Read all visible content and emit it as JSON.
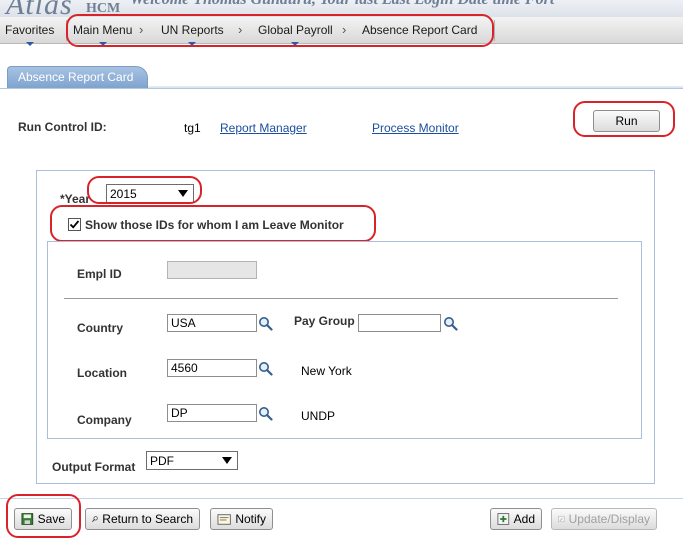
{
  "banner": {
    "brand": "Atlas",
    "brand_sub": "HCM",
    "message": "Welcome Thomas Gunduru, Your last Last Login Date time Fort"
  },
  "menubar": {
    "favorites": "Favorites",
    "breadcrumbs": [
      "Main Menu",
      "UN Reports",
      "Global Payroll",
      "Absence Report Card"
    ],
    "separator": "›"
  },
  "tab": {
    "label": "Absence Report Card"
  },
  "run_control": {
    "label": "Run Control ID:",
    "value": "tg1",
    "report_manager": "Report Manager",
    "process_monitor": "Process Monitor",
    "run_button": "Run"
  },
  "criteria": {
    "year_label": "*Year",
    "year_value": "2015",
    "checkbox_label": "Show those IDs for whom I am Leave Monitor",
    "checkbox_checked": true,
    "empl_id_label": "Empl ID",
    "empl_id_value": "",
    "country_label": "Country",
    "country_value": "USA",
    "pay_group_label": "Pay Group",
    "pay_group_value": "",
    "location_label": "Location",
    "location_value": "4560",
    "location_desc": "New York",
    "company_label": "Company",
    "company_value": "DP",
    "company_desc": "UNDP",
    "output_format_label": "Output Format",
    "output_format_value": "PDF"
  },
  "toolbar": {
    "save": "Save",
    "return_to_search": "Return to Search",
    "notify": "Notify",
    "add": "Add",
    "update_display": "Update/Display"
  },
  "colors": {
    "highlight": "#d8232a",
    "link": "#1b4e9e",
    "tab": "#8fb0d8"
  }
}
